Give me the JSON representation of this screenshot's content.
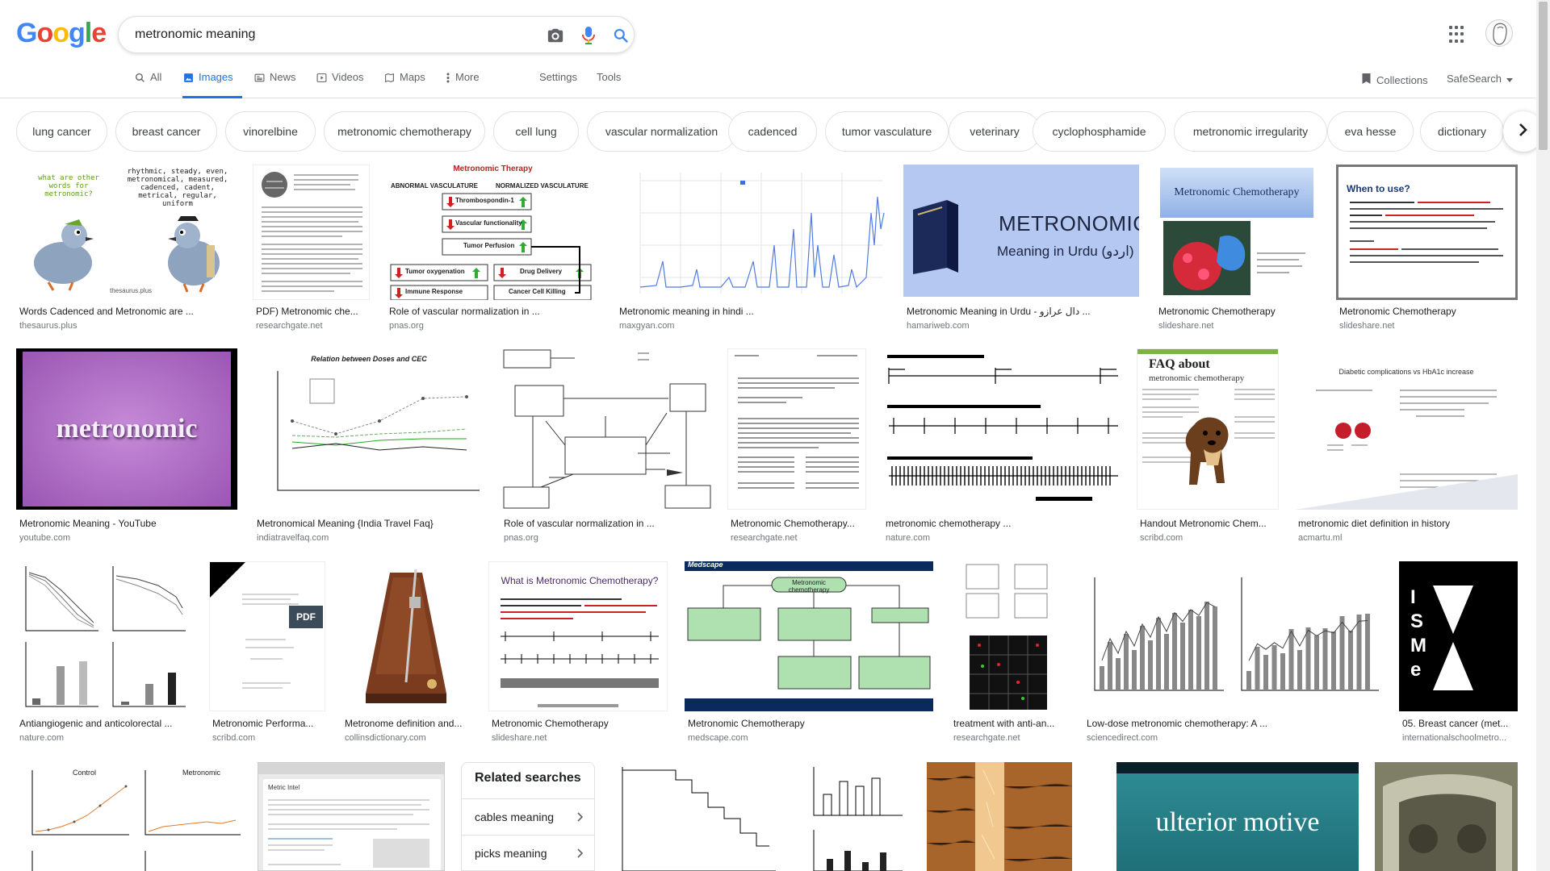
{
  "logo": "Google",
  "search": {
    "value": "metronomic meaning"
  },
  "tabs": [
    {
      "label": "All",
      "icon": "search-icon"
    },
    {
      "label": "Images",
      "icon": "image-icon"
    },
    {
      "label": "News",
      "icon": "news-icon"
    },
    {
      "label": "Videos",
      "icon": "play-icon"
    },
    {
      "label": "Maps",
      "icon": "map-pin-icon"
    },
    {
      "label": "More",
      "icon": "dots-vertical-icon"
    },
    {
      "label": "Settings"
    },
    {
      "label": "Tools"
    }
  ],
  "header_right": {
    "collections": "Collections",
    "safesearch": "SafeSearch"
  },
  "chips": [
    "lung cancer",
    "breast cancer",
    "vinorelbine",
    "metronomic chemotherapy",
    "cell lung",
    "vascular normalization",
    "cadenced",
    "tumor vasculature",
    "veterinary",
    "cyclophosphamide",
    "metronomic irregularity",
    "eva hesse",
    "dictionary"
  ],
  "results": [
    {
      "title": "Words Cadenced and Metronomic are ...",
      "site": "thesaurus.plus"
    },
    {
      "title": "PDF) Metronomic che...",
      "site": "researchgate.net"
    },
    {
      "title": "Role of vascular normalization in ...",
      "site": "pnas.org"
    },
    {
      "title": "Metronomic meaning in hindi ...",
      "site": "maxgyan.com"
    },
    {
      "title": "Metronomic Meaning in Urdu - دال عرازو ...",
      "site": "hamariweb.com"
    },
    {
      "title": "Metronomic Chemotherapy",
      "site": "slideshare.net"
    },
    {
      "title": "Metronomic Chemotherapy",
      "site": "slideshare.net"
    },
    {
      "title": "Metronomic Meaning - YouTube",
      "site": "youtube.com"
    },
    {
      "title": "Metronomical Meaning {India Travel Faq}",
      "site": "indiatravelfaq.com"
    },
    {
      "title": "Role of vascular normalization in ...",
      "site": "pnas.org"
    },
    {
      "title": "Metronomic Chemotherapy...",
      "site": "researchgate.net"
    },
    {
      "title": "metronomic chemotherapy ...",
      "site": "nature.com"
    },
    {
      "title": "Handout Metronomic Chem...",
      "site": "scribd.com"
    },
    {
      "title": "metronomic diet definition in history",
      "site": "acmartu.ml"
    },
    {
      "title": "Antiangiogenic and anticolorectal ...",
      "site": "nature.com"
    },
    {
      "title": "Metronomic Performa...",
      "site": "scribd.com"
    },
    {
      "title": "Metronome definition and...",
      "site": "collinsdictionary.com"
    },
    {
      "title": "Metronomic Chemotherapy",
      "site": "slideshare.net"
    },
    {
      "title": "Metronomic Chemotherapy",
      "site": "medscape.com"
    },
    {
      "title": "treatment with anti-an...",
      "site": "researchgate.net"
    },
    {
      "title": "Low-dose metronomic chemotherapy: A ...",
      "site": "sciencedirect.com"
    },
    {
      "title": "05. Breast cancer (met...",
      "site": "internationalschoolmetro..."
    }
  ],
  "thumb_text": {
    "thesaurus_q": "what are other words for metronomic?",
    "thesaurus_a": "rhythmic, steady, even, metronomical, measured, cadenced, cadent, metrical, regular, uniform",
    "thesaurus_src": "thesaurus.plus",
    "metro_therapy": "Metronomic Therapy",
    "abnormal": "ABNORMAL VASCULATURE",
    "normalized": "NORMALIZED VASCULATURE",
    "box1": "Thrombospondin-1",
    "box2": "Vascular functionality",
    "box3": "Tumor Perfusion",
    "box4": "Tumor oxygenation",
    "box5": "Drug Delivery",
    "box6": "Immune Response",
    "box7": "Cancer Cell Killing",
    "urdu_big": "METRONOMIC",
    "urdu_small": "Meaning in Urdu (اردو)",
    "slide_title": "Metronomic Chemotherapy",
    "when_to_use": "When to use?",
    "yt_word": "metronomic",
    "doses_title": "Relation between Doses and CEC",
    "faq_title": "FAQ about",
    "faq_sub": "metronomic chemotherapy",
    "diabetic_title": "Diabetic complications vs HbA1c increase",
    "pdf": "PDF",
    "what_is": "What is Metronomic Chemotherapy?",
    "medscape": "Medscape",
    "medscape_center": "Metronomic chemotherapy",
    "ulterior": "ulterior motive",
    "isme": "ISMe",
    "control": "Control",
    "metronomic_lbl": "Metronomic",
    "metric_intel": "Metric Intel"
  },
  "related": {
    "title": "Related searches",
    "items": [
      "cables meaning",
      "picks meaning"
    ]
  },
  "colors": {
    "accent": "#1a73e8",
    "google_blue": "#4285f4",
    "google_red": "#ea4335",
    "google_yellow": "#fbbc05",
    "google_green": "#34a853"
  }
}
